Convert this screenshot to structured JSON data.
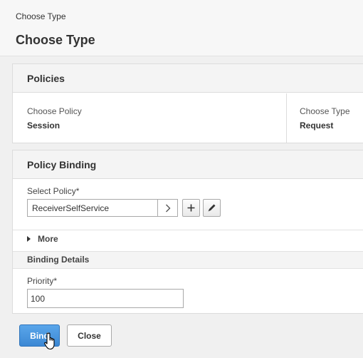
{
  "header": {
    "breadcrumb": "Choose Type",
    "title": "Choose Type"
  },
  "policies": {
    "title": "Policies",
    "left_label": "Choose Policy",
    "left_value": "Session",
    "right_label": "Choose Type",
    "right_value": "Request"
  },
  "binding": {
    "title": "Policy Binding",
    "select_label": "Select Policy*",
    "select_value": "ReceiverSelfService",
    "more_label": "More",
    "details_title": "Binding Details",
    "priority_label": "Priority*",
    "priority_value": "100"
  },
  "footer": {
    "bind_label": "Bind",
    "close_label": "Close"
  },
  "colors": {
    "primary_button": "#3c88d4"
  },
  "icons": [
    "chevron-right-icon",
    "plus-icon",
    "pencil-icon",
    "triangle-right-icon",
    "hand-cursor-icon"
  ]
}
